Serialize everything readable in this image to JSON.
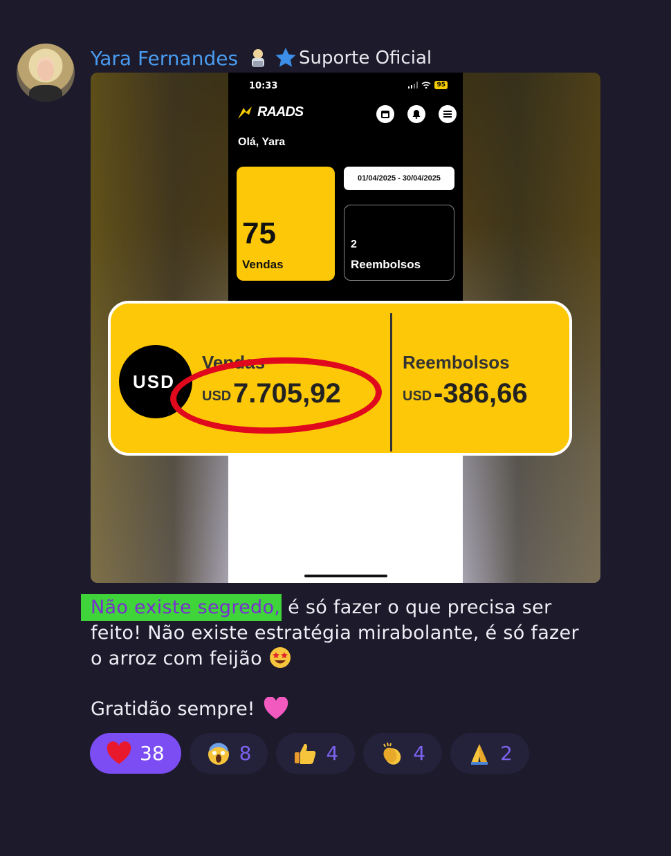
{
  "post": {
    "author_name": "Yara Fernandes",
    "author_badge_icon": "person-laptop-icon",
    "role_icon": "star-icon",
    "role_label": "Suporte Oficial"
  },
  "screenshot": {
    "phone": {
      "time": "10:33",
      "battery": "95",
      "app_logo": "RAADS",
      "greeting": "Olá, Yara",
      "date_range": "01/04/2025 - 30/04/2025",
      "sales_count": "75",
      "sales_label": "Vendas",
      "refunds_count": "2",
      "refunds_label": "Reembolsos"
    },
    "overlay": {
      "currency_badge": "USD",
      "sales_label": "Vendas",
      "sales_currency": "USD",
      "sales_value": "7.705,92",
      "refunds_label": "Reembolsos",
      "refunds_currency": "USD",
      "refunds_value": "-386,66"
    }
  },
  "message": {
    "highlight": "Não existe segredo,",
    "text": " é só fazer o que precisa ser feito! Não existe estratégia mirabolante, é só fazer o arroz com feijão",
    "emoji_1": "star-struck-emoji",
    "closing": "Gratidão sempre!",
    "emoji_2": "pink-heart-emoji"
  },
  "reactions": [
    {
      "icon": "red-heart-icon",
      "count": "38",
      "active": true
    },
    {
      "icon": "screaming-face-icon",
      "count": "8",
      "active": false
    },
    {
      "icon": "thumbs-up-icon",
      "count": "4",
      "active": false
    },
    {
      "icon": "clapping-hands-icon",
      "count": "4",
      "active": false
    },
    {
      "icon": "folded-hands-icon",
      "count": "2",
      "active": false
    }
  ],
  "colors": {
    "background": "#1c1a2b",
    "author": "#4a9cf0",
    "reaction_active": "#7c4df3",
    "reaction_count": "#7c63f0",
    "highlight_bg": "#3ed43a",
    "highlight_text": "#7a2fd0",
    "card_yellow": "#fcc808",
    "circle_red": "#e0081c"
  }
}
